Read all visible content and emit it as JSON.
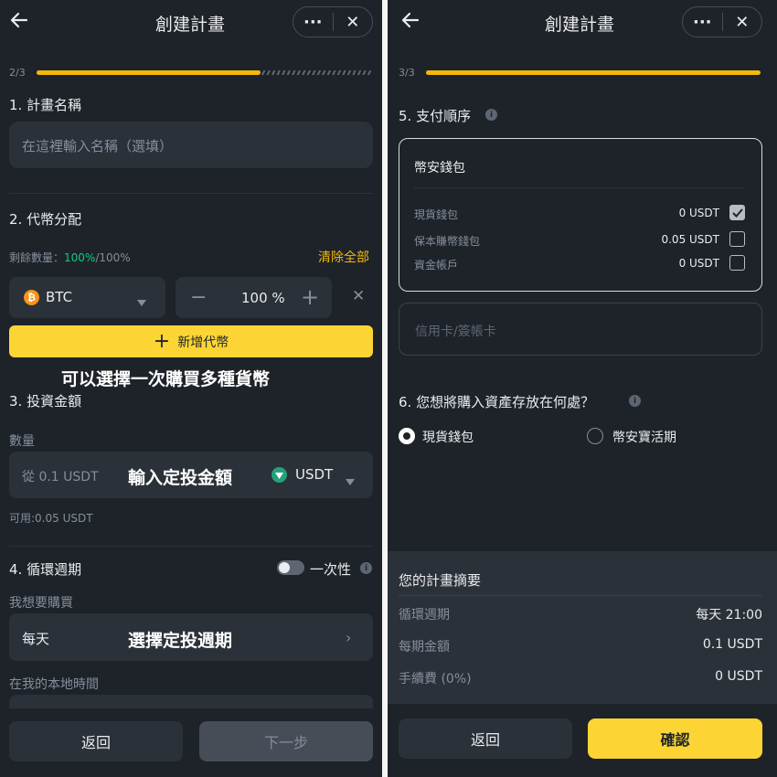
{
  "left": {
    "header": {
      "title": "創建計畫"
    },
    "progress": {
      "step": "2/3",
      "fraction": 0.667
    },
    "section1": {
      "title": "1. 計畫名稱",
      "name_placeholder": "在這裡輸入名稱（選填）"
    },
    "section2": {
      "title": "2. 代幣分配",
      "remaining_label": "剩餘數量：",
      "remaining_value": "100%",
      "remaining_total": "/100%",
      "clear_all": "清除全部",
      "coin": "BTC",
      "coin_icon": "bitcoin-icon",
      "percent": "100 %",
      "add_coin": "新增代幣",
      "annotation": "可以選擇一次購買多種貨幣"
    },
    "section3": {
      "title": "3. 投資金額",
      "amount_label": "數量",
      "amount_placeholder": "從 0.1 USDT",
      "annotation": "輸入定投金額",
      "currency": "USDT",
      "available": "可用:0.05 USDT"
    },
    "section4": {
      "title": "4. 循環週期",
      "one_time": "一次性",
      "buy_label": "我想要購買",
      "frequency": "每天",
      "annotation": "選擇定投週期",
      "local_time_label": "在我的本地時間"
    },
    "footer": {
      "back": "返回",
      "next": "下一步"
    }
  },
  "right": {
    "header": {
      "title": "創建計畫"
    },
    "progress": {
      "step": "3/3",
      "fraction": 1.0
    },
    "section5": {
      "title": "5. 支付順序",
      "wallet_title": "幣安錢包",
      "wallets": [
        {
          "name": "現貨錢包",
          "amount": "0 USDT",
          "checked": true
        },
        {
          "name": "保本賺幣錢包",
          "amount": "0.05 USDT",
          "checked": false
        },
        {
          "name": "資金帳戶",
          "amount": "0 USDT",
          "checked": false
        }
      ],
      "card": "信用卡/簽帳卡"
    },
    "section6": {
      "title": "6. 您想將購入資產存放在何處？",
      "option1": "現貨錢包",
      "option2": "幣安寶活期"
    },
    "summary": {
      "title": "您的計畫摘要",
      "rows": [
        {
          "label": "循環週期",
          "value": "每天 21:00"
        },
        {
          "label": "每期金額",
          "value": "0.1 USDT"
        },
        {
          "label": "手續費 (0%)",
          "value": "0 USDT"
        }
      ]
    },
    "footer": {
      "back": "返回",
      "confirm": "確認"
    }
  },
  "colors": {
    "accent": "#fcd535",
    "background": "#1e2329",
    "field": "#2b3139",
    "green": "#0ecb81"
  }
}
